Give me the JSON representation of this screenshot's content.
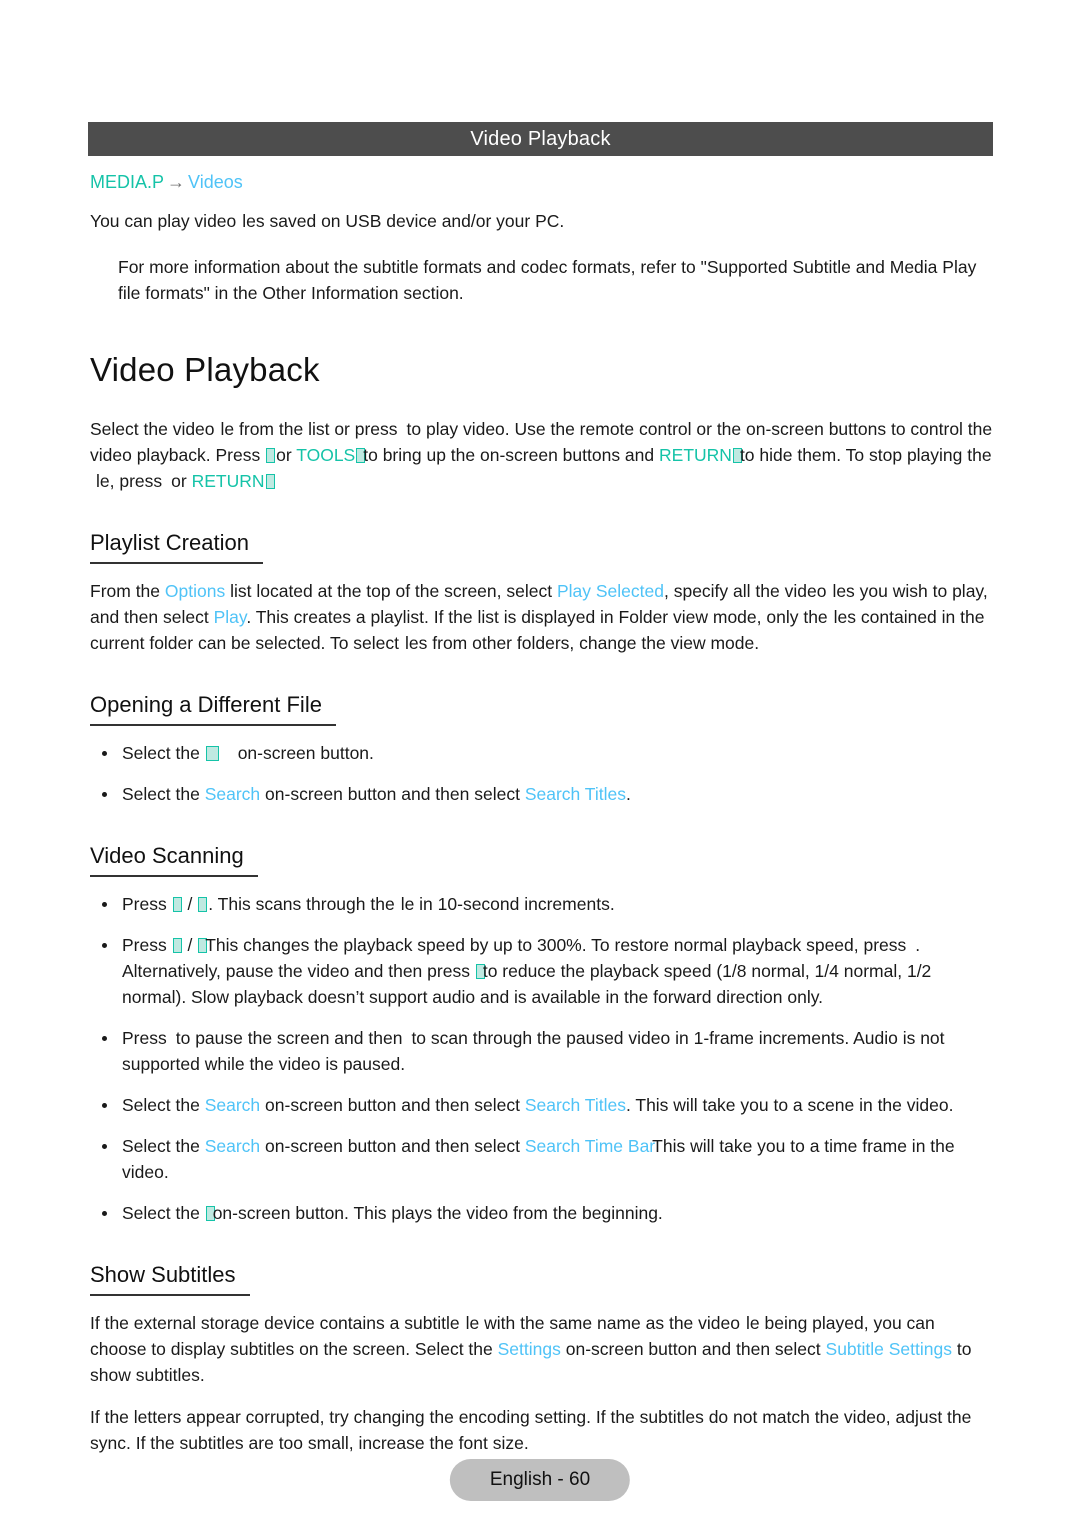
{
  "header": {
    "title": "Video Playback"
  },
  "breadcrumb": {
    "root": "MEDIA.P",
    "arrow": "→",
    "leaf": "Videos"
  },
  "intro": {
    "lead_a": "You can play video",
    "lead_b": "les saved on USB device and/or your PC.",
    "note": "For more information about the subtitle formats and codec formats, refer to \"Supported Subtitle and Media Play file formats\" in the Other Information section."
  },
  "doc_title": "Video Playback",
  "body": {
    "p1_a": "Select the video",
    "p1_b": "le from the list or press",
    "p1_c": "to play video. Use the remote control or the on-screen buttons to control the video playback. Press",
    "p1_d": "or",
    "p1_tools": "TOOLS",
    "p1_e": "to bring up the on-screen buttons and",
    "p1_return1": "RETURN",
    "p1_f": "to hide them. To stop playing the",
    "p1_g": "le, press",
    "p1_h": "or",
    "p1_return2": "RETURN"
  },
  "sections": [
    {
      "heading": "Playlist Creation",
      "paragraph": {
        "a": "From the",
        "options": "Options",
        "b": "list located at the top of the screen, select",
        "play_selected": "Play Selected",
        "c": ", specify all the video",
        "d": "les you wish to play, and then select",
        "play": "Play",
        "e": ". This creates a playlist. If the list is displayed in Folder view mode, only the",
        "f": "les contained in the current folder can be selected. To select",
        "g": "les from other folders, change the view mode."
      }
    },
    {
      "heading": "Opening a Different File",
      "bullets": [
        {
          "a": "Select the",
          "b": "on-screen button."
        },
        {
          "a": "Select the",
          "search": "Search",
          "b": "on-screen button and then select",
          "search_titles": "Search Titles",
          "c": "."
        }
      ]
    },
    {
      "heading": "Video Scanning",
      "bullets": [
        {
          "a": "Press",
          "sep": "/",
          "b": ". This scans through the",
          "c": "le in 10-second increments."
        },
        {
          "a": "Press",
          "sep": "/",
          "b": "This changes the playback speed by up to 300%. To restore normal playback speed, press",
          "c": ". Alternatively, pause the video and then press",
          "d": "to reduce the playback speed (1/8 normal, 1/4 normal, 1/2 normal). Slow playback doesn’t support audio and is available in the forward direction only."
        },
        {
          "a": "Press",
          "b": "to pause the screen and then",
          "c": "to scan through the paused video in 1-frame increments. Audio is not supported while the video is paused."
        },
        {
          "a": "Select the",
          "search": "Search",
          "b": "on-screen button and then select",
          "search_titles": "Search Titles",
          "c": ". This will take you to a scene in the video."
        },
        {
          "a": "Select the",
          "search": "Search",
          "b": "on-screen button and then select",
          "search_time_bar": "Search Time Bar",
          "c": "This will take you to a time frame in the video."
        },
        {
          "a": "Select the",
          "b": "on-screen button. This plays the video from the beginning."
        }
      ]
    },
    {
      "heading": "Show Subtitles",
      "paragraphs": {
        "p1_a": "If the external storage device contains a subtitle",
        "p1_b": "le with the same name as the video",
        "p1_c": "le being played, you can choose to display subtitles on the screen. Select the",
        "settings": "Settings",
        "p1_d": "on-screen button and then select",
        "subtitle_settings": "Subtitle Settings",
        "p1_e": "to show subtitles.",
        "p2": "If the letters appear corrupted, try changing the encoding setting. If the subtitles do not match the video, adjust the sync. If the subtitles are too small, increase the font size."
      }
    }
  ],
  "footer": {
    "label": "English - 60"
  },
  "colors": {
    "header_bar": "#4d4d4d",
    "link_blue": "#4fc3f7",
    "key_teal": "#15c3a8",
    "footer_pill": "#bfbfbf"
  }
}
